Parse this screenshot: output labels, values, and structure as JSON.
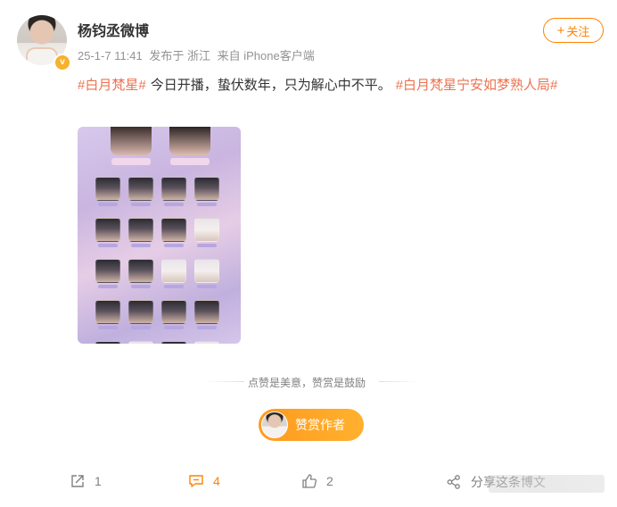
{
  "user": {
    "name": "杨钧丞微博",
    "verified_badge": "v",
    "time": "25-1-7 11:41",
    "location": "发布于 浙江",
    "source": "来自 iPhone客户端"
  },
  "follow_button": {
    "plus": "+",
    "label": "关注"
  },
  "post": {
    "tag1": "#白月梵星#",
    "text": "今日开播，蛰伏数年，只为解心中不平。",
    "tag2": "#白月梵星宁安如梦熟人局#"
  },
  "reward": {
    "divider_text": "点赞是美意，赞赏是鼓励",
    "button_label": "赞赏作者"
  },
  "actions": {
    "share_count": "1",
    "comment_count": "4",
    "like_count": "2",
    "share_card_label": "分享这条博文"
  },
  "colors": {
    "accent": "#ff8200",
    "tag": "#eb7350",
    "badge": "#f7b12b"
  },
  "icons": {
    "share": "share-icon",
    "comment": "comment-icon",
    "like": "thumbs-up-icon",
    "share_card": "share-node-icon"
  }
}
